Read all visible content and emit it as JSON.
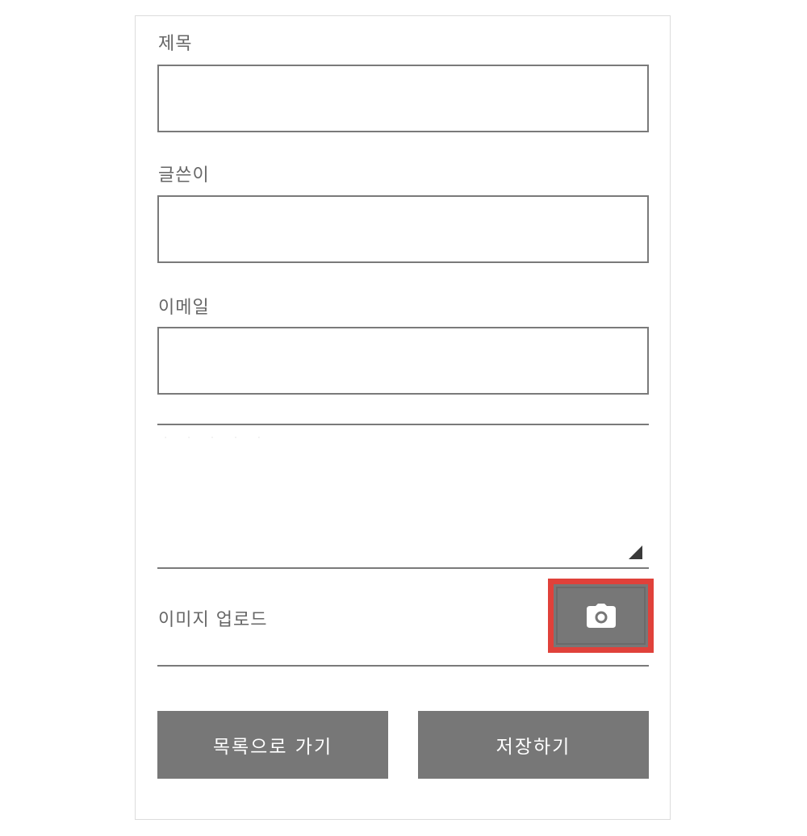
{
  "form": {
    "title_label": "제목",
    "author_label": "글쓴이",
    "email_label": "이메일",
    "content_ghost": "· · · · ·",
    "upload_label": "이미지 업로드",
    "upload_icon": "camera-icon",
    "back_button": "목록으로 가기",
    "save_button": "저장하기"
  },
  "colors": {
    "field_border": "#7a7a7a",
    "label_text": "#666666",
    "button_bg": "#777777",
    "button_text": "#ffffff",
    "highlight": "#e0413a"
  }
}
